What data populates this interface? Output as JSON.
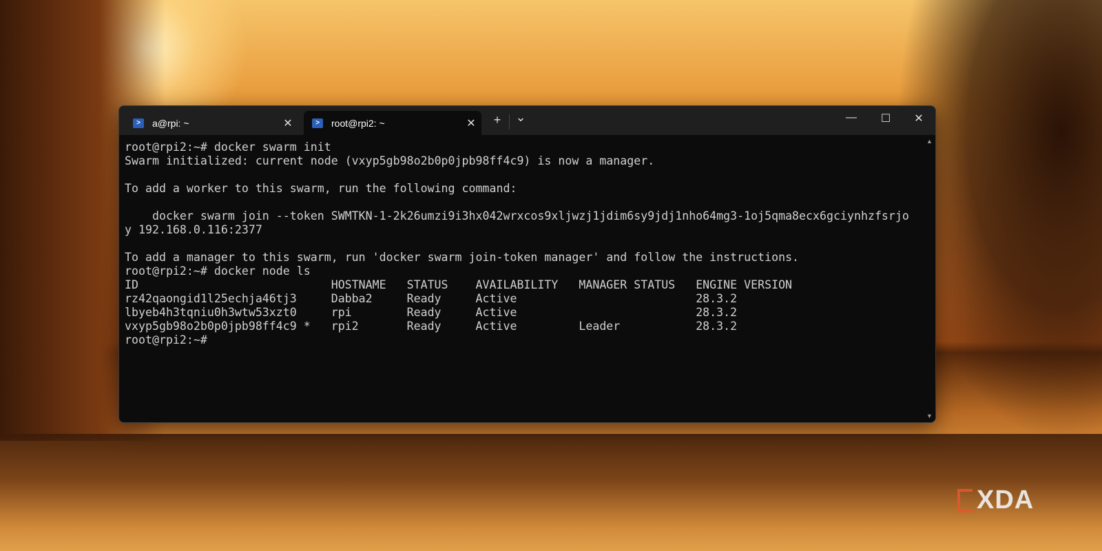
{
  "tabs": [
    {
      "label": "a@rpi: ~",
      "icon": "powershell-icon"
    },
    {
      "label": "root@rpi2: ~",
      "icon": "powershell-icon",
      "active": true
    }
  ],
  "tabbar": {
    "new_tab": "+",
    "dropdown": "⌄"
  },
  "window_controls": {
    "minimize": "—",
    "maximize": "☐",
    "close": "✕"
  },
  "terminal": {
    "lines": [
      "root@rpi2:~# docker swarm init",
      "Swarm initialized: current node (vxyp5gb98o2b0p0jpb98ff4c9) is now a manager.",
      "",
      "To add a worker to this swarm, run the following command:",
      "",
      "    docker swarm join --token SWMTKN-1-2k26umzi9i3hx042wrxcos9xljwzj1jdim6sy9jdj1nho64mg3-1oj5qma8ecx6gciynhzfsrjo",
      "y 192.168.0.116:2377",
      "",
      "To add a manager to this swarm, run 'docker swarm join-token manager' and follow the instructions.",
      "root@rpi2:~# docker node ls"
    ],
    "table": {
      "headers": [
        "ID",
        "HOSTNAME",
        "STATUS",
        "AVAILABILITY",
        "MANAGER STATUS",
        "ENGINE VERSION"
      ],
      "rows": [
        [
          "rz42qaongid1l25echja46tj3",
          "Dabba2",
          "Ready",
          "Active",
          "",
          "28.3.2"
        ],
        [
          "lbyeb4h3tqniu0h3wtw53xzt0",
          "rpi",
          "Ready",
          "Active",
          "",
          "28.3.2"
        ],
        [
          "vxyp5gb98o2b0p0jpb98ff4c9 *",
          "rpi2",
          "Ready",
          "Active",
          "Leader",
          "28.3.2"
        ]
      ]
    },
    "prompt": "root@rpi2:~#"
  },
  "watermark": "XDA"
}
